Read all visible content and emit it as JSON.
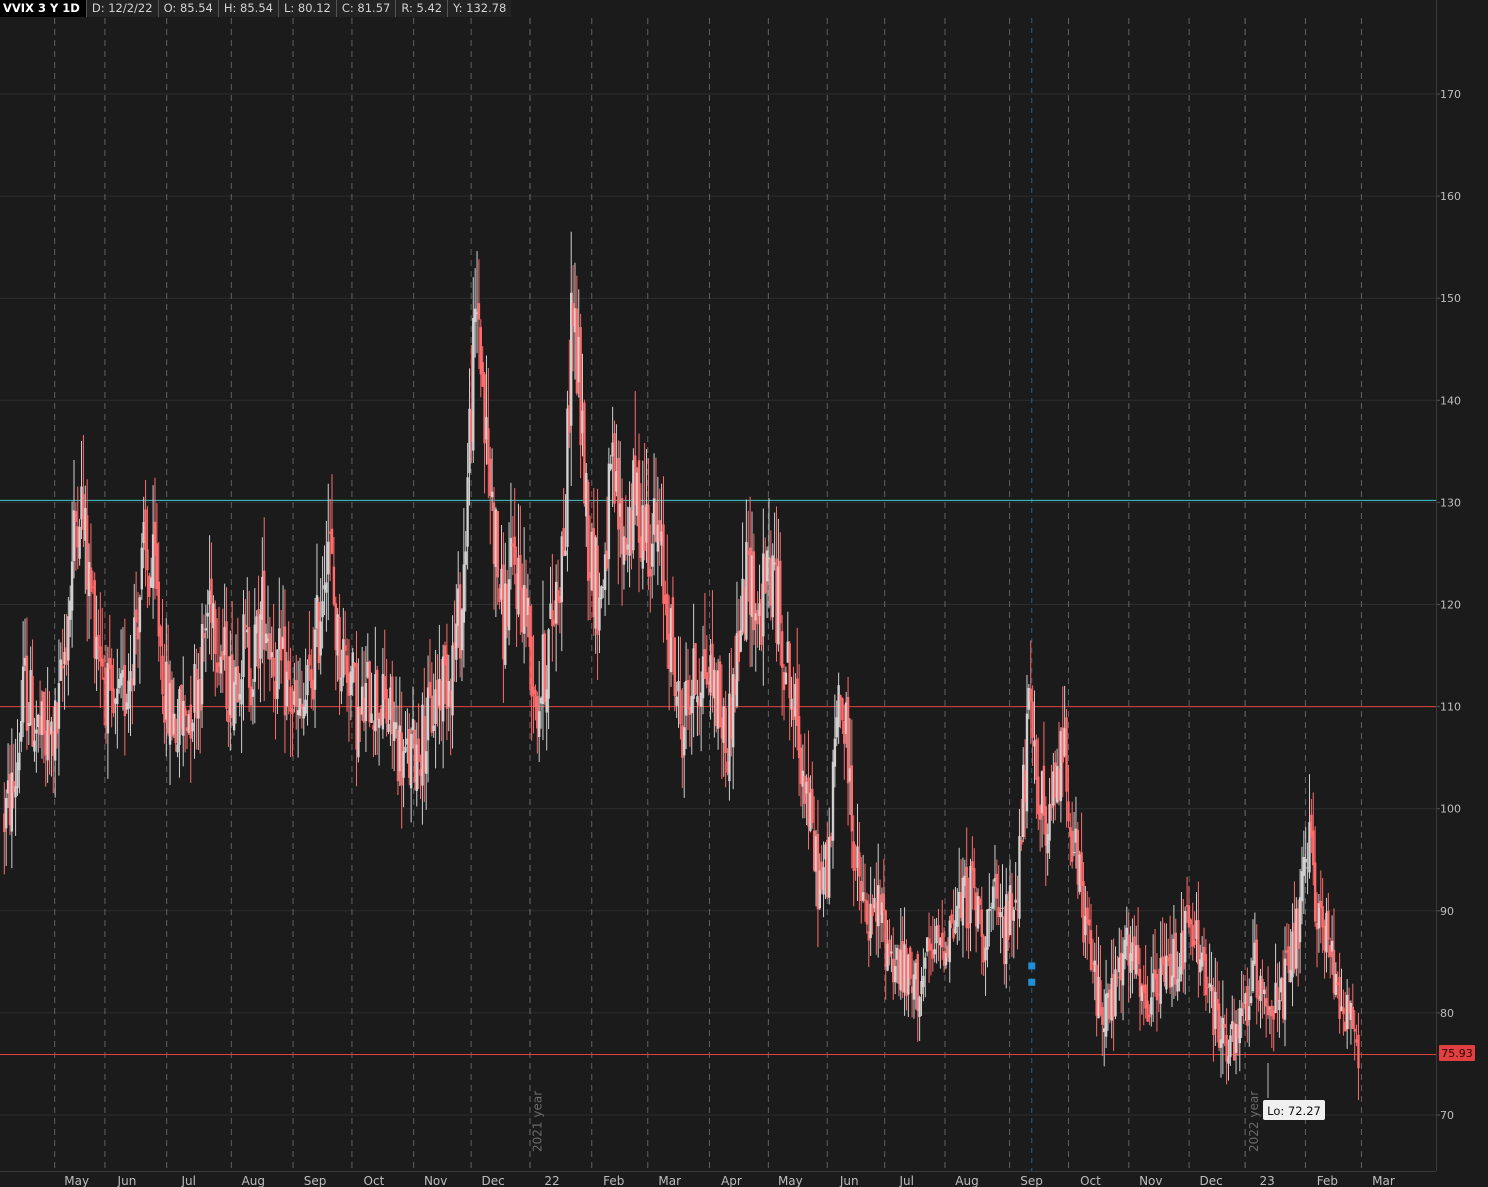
{
  "header": {
    "symbol": "VVIX 3 Y 1D",
    "date": "D: 12/2/22",
    "open": "O: 85.54",
    "high": "H: 85.54",
    "low": "L: 80.12",
    "close": "C: 81.57",
    "range": "R: 5.42",
    "y": "Y: 132.78"
  },
  "price_badge": "75.93",
  "low_label": "Lo: 72.27",
  "colors": {
    "background": "#1b1b1b",
    "up": "#d0d0d0",
    "down": "#ff6b6b",
    "cyan_line": "#3ec9c9",
    "red_line": "#e0403f",
    "grid": "#2c2c2c"
  },
  "chart_data": {
    "type": "candlestick",
    "y_axis": {
      "range": [
        65,
        176
      ],
      "ticks": [
        70,
        80,
        90,
        100,
        110,
        120,
        130,
        140,
        150,
        160,
        170
      ]
    },
    "x_axis": {
      "months": [
        {
          "label": "May",
          "pos": 0.052
        },
        {
          "label": "Jun",
          "pos": 0.087
        },
        {
          "label": "Jul",
          "pos": 0.13
        },
        {
          "label": "Aug",
          "pos": 0.175
        },
        {
          "label": "Sep",
          "pos": 0.218
        },
        {
          "label": "Oct",
          "pos": 0.259
        },
        {
          "label": "Nov",
          "pos": 0.302
        },
        {
          "label": "Dec",
          "pos": 0.342
        },
        {
          "label": "22",
          "pos": 0.383
        },
        {
          "label": "Feb",
          "pos": 0.426
        },
        {
          "label": "Mar",
          "pos": 0.465
        },
        {
          "label": "Apr",
          "pos": 0.508
        },
        {
          "label": "May",
          "pos": 0.549
        },
        {
          "label": "Jun",
          "pos": 0.59
        },
        {
          "label": "Jul",
          "pos": 0.63
        },
        {
          "label": "Aug",
          "pos": 0.672
        },
        {
          "label": "Sep",
          "pos": 0.717
        },
        {
          "label": "Oct",
          "pos": 0.758
        },
        {
          "label": "Nov",
          "pos": 0.8
        },
        {
          "label": "Dec",
          "pos": 0.842
        },
        {
          "label": "23",
          "pos": 0.881
        },
        {
          "label": "Feb",
          "pos": 0.923
        },
        {
          "label": "Mar",
          "pos": 0.962
        }
      ],
      "year_labels": [
        {
          "label": "2021 year",
          "pos": 0.375
        },
        {
          "label": "2022 year",
          "pos": 0.874
        }
      ]
    },
    "horizontal_lines": [
      {
        "value": 130.2,
        "color": "cyan"
      },
      {
        "value": 110,
        "color": "red"
      },
      {
        "value": 75.93,
        "color": "red"
      }
    ],
    "series": [
      {
        "name": "",
        "anchors": [
          [
            0.0,
            98
          ],
          [
            0.01,
            102
          ],
          [
            0.017,
            112
          ],
          [
            0.025,
            108
          ],
          [
            0.032,
            106
          ],
          [
            0.04,
            108
          ],
          [
            0.048,
            120
          ],
          [
            0.055,
            132
          ],
          [
            0.062,
            122
          ],
          [
            0.07,
            116
          ],
          [
            0.078,
            108
          ],
          [
            0.085,
            110
          ],
          [
            0.092,
            116
          ],
          [
            0.1,
            124
          ],
          [
            0.108,
            122
          ],
          [
            0.116,
            110
          ],
          [
            0.124,
            108
          ],
          [
            0.132,
            110
          ],
          [
            0.14,
            114
          ],
          [
            0.147,
            122
          ],
          [
            0.153,
            116
          ],
          [
            0.16,
            112
          ],
          [
            0.168,
            116
          ],
          [
            0.176,
            114
          ],
          [
            0.184,
            120
          ],
          [
            0.192,
            114
          ],
          [
            0.2,
            112
          ],
          [
            0.208,
            108
          ],
          [
            0.216,
            112
          ],
          [
            0.222,
            118
          ],
          [
            0.228,
            128
          ],
          [
            0.235,
            116
          ],
          [
            0.243,
            114
          ],
          [
            0.25,
            108
          ],
          [
            0.258,
            112
          ],
          [
            0.266,
            110
          ],
          [
            0.274,
            108
          ],
          [
            0.282,
            104
          ],
          [
            0.29,
            106
          ],
          [
            0.298,
            108
          ],
          [
            0.306,
            112
          ],
          [
            0.314,
            114
          ],
          [
            0.322,
            120
          ],
          [
            0.328,
            140
          ],
          [
            0.333,
            150
          ],
          [
            0.338,
            136
          ],
          [
            0.344,
            128
          ],
          [
            0.35,
            118
          ],
          [
            0.358,
            124
          ],
          [
            0.366,
            120
          ],
          [
            0.374,
            110
          ],
          [
            0.382,
            116
          ],
          [
            0.388,
            122
          ],
          [
            0.394,
            128
          ],
          [
            0.398,
            150
          ],
          [
            0.404,
            140
          ],
          [
            0.41,
            126
          ],
          [
            0.418,
            120
          ],
          [
            0.426,
            132
          ],
          [
            0.434,
            126
          ],
          [
            0.442,
            130
          ],
          [
            0.45,
            128
          ],
          [
            0.458,
            126
          ],
          [
            0.466,
            118
          ],
          [
            0.474,
            108
          ],
          [
            0.482,
            112
          ],
          [
            0.49,
            114
          ],
          [
            0.498,
            112
          ],
          [
            0.506,
            106
          ],
          [
            0.514,
            116
          ],
          [
            0.522,
            124
          ],
          [
            0.528,
            118
          ],
          [
            0.536,
            124
          ],
          [
            0.544,
            118
          ],
          [
            0.552,
            110
          ],
          [
            0.56,
            104
          ],
          [
            0.566,
            96
          ],
          [
            0.572,
            92
          ],
          [
            0.578,
            96
          ],
          [
            0.584,
            112
          ],
          [
            0.59,
            106
          ],
          [
            0.596,
            94
          ],
          [
            0.604,
            88
          ],
          [
            0.612,
            90
          ],
          [
            0.62,
            86
          ],
          [
            0.628,
            84
          ],
          [
            0.636,
            82
          ],
          [
            0.644,
            84
          ],
          [
            0.652,
            86
          ],
          [
            0.66,
            88
          ],
          [
            0.668,
            90
          ],
          [
            0.676,
            92
          ],
          [
            0.684,
            88
          ],
          [
            0.692,
            90
          ],
          [
            0.7,
            88
          ],
          [
            0.708,
            92
          ],
          [
            0.716,
            108
          ],
          [
            0.722,
            104
          ],
          [
            0.73,
            96
          ],
          [
            0.736,
            104
          ],
          [
            0.742,
            106
          ],
          [
            0.748,
            96
          ],
          [
            0.756,
            88
          ],
          [
            0.764,
            82
          ],
          [
            0.772,
            80
          ],
          [
            0.78,
            84
          ],
          [
            0.788,
            86
          ],
          [
            0.796,
            80
          ],
          [
            0.804,
            82
          ],
          [
            0.812,
            84
          ],
          [
            0.82,
            86
          ],
          [
            0.828,
            88
          ],
          [
            0.836,
            86
          ],
          [
            0.844,
            80
          ],
          [
            0.852,
            78
          ],
          [
            0.86,
            76
          ],
          [
            0.866,
            80
          ],
          [
            0.874,
            84
          ],
          [
            0.882,
            82
          ],
          [
            0.89,
            80
          ],
          [
            0.898,
            84
          ],
          [
            0.906,
            90
          ],
          [
            0.912,
            96
          ],
          [
            0.918,
            90
          ],
          [
            0.926,
            86
          ],
          [
            0.934,
            82
          ],
          [
            0.942,
            79
          ],
          [
            0.946,
            76
          ]
        ]
      }
    ],
    "markers": [
      {
        "pos": 0.7185,
        "value": 84.6
      },
      {
        "pos": 0.7185,
        "value": 83.0
      }
    ],
    "low_marker": {
      "pos": 0.853,
      "value": 72.27
    }
  }
}
